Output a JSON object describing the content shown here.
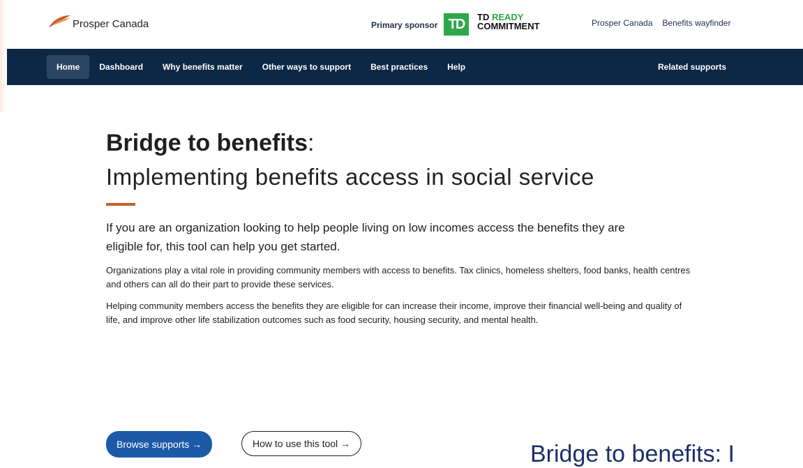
{
  "header": {
    "brand": "Prosper Canada",
    "sponsor_label": "Primary sponsor",
    "td_logo_text": "TD",
    "td_ready_line1_a": "TD ",
    "td_ready_line1_b": "READY",
    "td_ready_line2": "COMMITMENT",
    "top_links": [
      "Prosper Canada",
      "Benefits wayfinder"
    ]
  },
  "nav": {
    "items": [
      "Home",
      "Dashboard",
      "Why benefits matter",
      "Other ways to support",
      "Best practices",
      "Help"
    ],
    "right": "Related supports"
  },
  "main": {
    "title_bold": "Bridge to benefits",
    "title_colon": ":",
    "subtitle": "Implementing benefits access in social service",
    "lead": "If you are an organization looking to help people living on low incomes access the benefits they are eligible for, this tool can help you get started.",
    "para1": "Organizations play a vital role in providing community members with access to benefits. Tax clinics, homeless shelters, food banks, health centres and others can all do their part to provide these services.",
    "para2": "Helping community members access the benefits they are eligible for can increase their income, improve their financial well-being and quality of life, and improve other life stabilization outcomes such as food security, housing security, and mental health.",
    "btn_browse": "Browse supports →",
    "btn_howto": "How to use this tool →",
    "overlay": "Bridge to benefits: I"
  },
  "colors": {
    "navy": "#0d2747",
    "accent": "#c75f2d",
    "primary_button": "#1c5aa8",
    "td_green": "#2ea84a"
  }
}
